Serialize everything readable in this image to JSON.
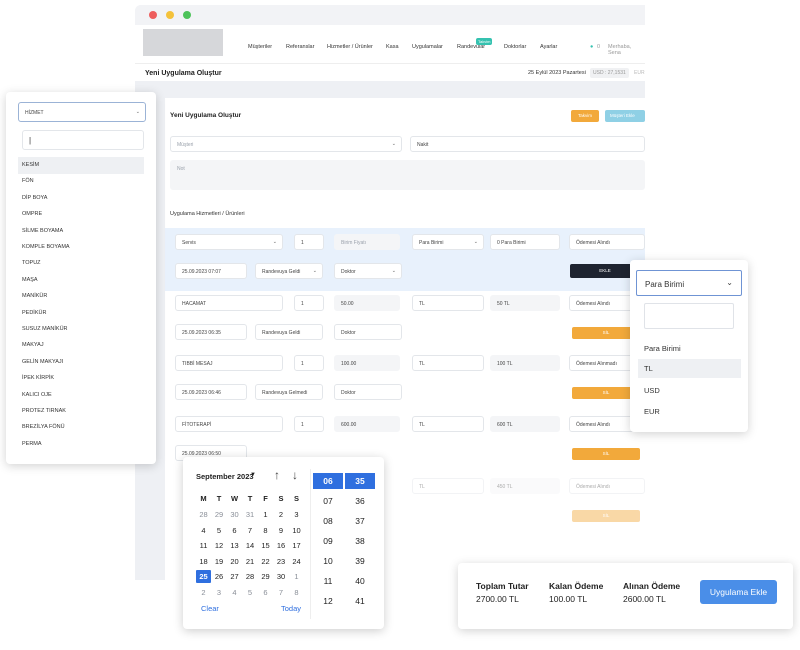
{
  "nav": {
    "items": [
      "Müşteriler",
      "Referanslar",
      "Hizmetler / Ürünler",
      "Kasa",
      "Uygulamalar",
      "Randevular",
      "Doktorlar",
      "Ayarlar"
    ],
    "badge": "Takvim",
    "user": "Merhaba, Sena",
    "notif_count": "0"
  },
  "subbar": {
    "title": "Yeni Uygulama Oluştur",
    "date": "25 Eylül 2023 Pazartesi",
    "rate": "USD : 27,1531",
    "rate2": "EUR"
  },
  "form": {
    "title": "Yeni Uygulama Oluştur",
    "btn_takvim": "Takvim",
    "btn_musteri": "Müşteri Ekle",
    "customer_placeholder": "Müşteri",
    "payment_type": "Nakit",
    "note_placeholder": "Not",
    "section_title": "Uygulama Hizmetleri / Ürünleri"
  },
  "newrow": {
    "service": "Servis",
    "qty": "1",
    "price_placeholder": "Birim Fiyatı",
    "currency": "Para Birimi",
    "total": "0 Para Birimi",
    "pay_status": "Ödemesi Alındı",
    "datetime": "25.09.2023 07:07",
    "status": "Randevuya Geldi",
    "doctor": "Doktor",
    "add_btn": "EKLE"
  },
  "rows": [
    {
      "service": "HACAMAT",
      "qty": "1",
      "price": "50.00",
      "cur": "TL",
      "total": "50 TL",
      "pay": "Ödemesi Alındı",
      "dt": "25.09.2023 06:35",
      "status": "Randevuya Geldi",
      "doctor": "Doktor",
      "del": "SİL"
    },
    {
      "service": "TIBBİ MESAJ",
      "qty": "1",
      "price": "100.00",
      "cur": "TL",
      "total": "100 TL",
      "pay": "Ödemesi Alınmadı",
      "dt": "25.09.2023 06:46",
      "status": "Randevuya Gelmedi",
      "doctor": "Doktor",
      "del": "SİL"
    },
    {
      "service": "FİTOTERAPİ",
      "qty": "1",
      "price": "600.00",
      "cur": "TL",
      "total": "600 TL",
      "pay": "Ödemesi Alındı",
      "dt": "25.09.2023 06:50",
      "status": "",
      "doctor": "",
      "del": "SİL"
    },
    {
      "service": "",
      "qty": "",
      "price": "",
      "cur": "TL",
      "total": "450 TL",
      "pay": "Ödemesi Alındı",
      "dt": "",
      "status": "",
      "doctor": "",
      "del": "SİL"
    }
  ],
  "left_dropdown": {
    "selected": "HİZMET",
    "search_value": "",
    "items": [
      "KESİM",
      "FÖN",
      "DİP BOYA",
      "OMPRE",
      "SİLME BOYAMA",
      "KOMPLE BOYAMA",
      "TOPUZ",
      "MAŞA",
      "MANİKÜR",
      "PEDİKÜR",
      "SUSUZ MANİKÜR",
      "MAKYAJ",
      "GELİN MAKYAJI",
      "İPEK KİRPİK",
      "KALICI OJE",
      "PROTEZ TIRNAK",
      "BREZİLYA FÖNÜ",
      "PERMA"
    ]
  },
  "currency_dropdown": {
    "selected": "Para Birimi",
    "options": [
      "Para Birimi",
      "TL",
      "USD",
      "EUR"
    ]
  },
  "datepicker": {
    "month": "September 2023",
    "weekdays": [
      "M",
      "T",
      "W",
      "T",
      "F",
      "S",
      "S"
    ],
    "weeks": [
      [
        "28",
        "29",
        "30",
        "31",
        "1",
        "2",
        "3"
      ],
      [
        "4",
        "5",
        "6",
        "7",
        "8",
        "9",
        "10"
      ],
      [
        "11",
        "12",
        "13",
        "14",
        "15",
        "16",
        "17"
      ],
      [
        "18",
        "19",
        "20",
        "21",
        "22",
        "23",
        "24"
      ],
      [
        "25",
        "26",
        "27",
        "28",
        "29",
        "30",
        "1"
      ],
      [
        "2",
        "3",
        "4",
        "5",
        "6",
        "7",
        "8"
      ]
    ],
    "selected_day": "25",
    "hours": [
      "06",
      "07",
      "08",
      "09",
      "10",
      "11",
      "12"
    ],
    "minutes": [
      "35",
      "36",
      "37",
      "38",
      "39",
      "40",
      "41"
    ],
    "selected_hour": "06",
    "selected_minute": "35",
    "clear": "Clear",
    "today": "Today"
  },
  "totals": {
    "labels": [
      "Toplam Tutar",
      "Kalan Ödeme",
      "Alınan Ödeme"
    ],
    "values": [
      "2700.00 TL",
      "100.00 TL",
      "2600.00 TL"
    ],
    "button": "Uygulama Ekle"
  },
  "colors": {
    "accent": "#2f6fdf",
    "orange": "#f2a93b",
    "teal": "#35c2b0",
    "button_blue": "#4a8ee8"
  }
}
